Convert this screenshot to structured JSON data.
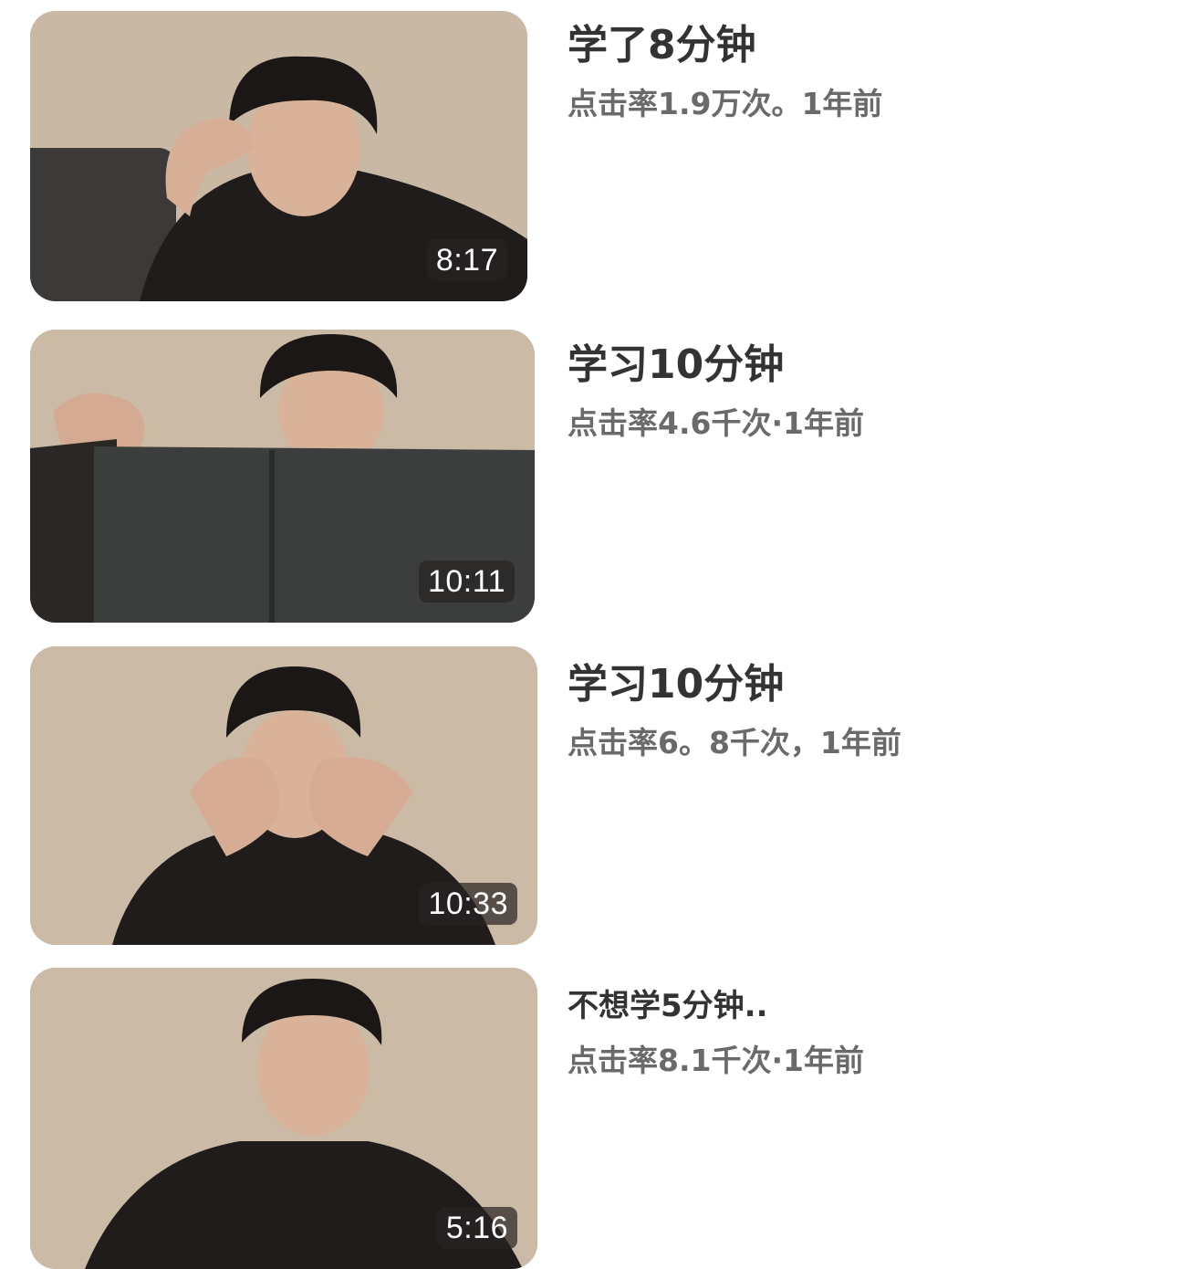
{
  "colors": {
    "background": "#ffffff",
    "title_text": "#333333",
    "subtitle_text": "#6a6a6a",
    "duration_badge_bg": "#282422",
    "thumbnail_wall": "#cbbba7"
  },
  "videos": [
    {
      "title": "学了8分钟",
      "stats": "点击率1.9万次。1年前",
      "duration": "8:17"
    },
    {
      "title": "学习10分钟",
      "stats": "点击率4.6千次·1年前",
      "duration": "10:11"
    },
    {
      "title": "学习10分钟",
      "stats": "点击率6。8千次，1年前",
      "duration": "10:33"
    },
    {
      "title": "不想学5分钟..",
      "stats": "点击率8.1千次·1年前",
      "duration": "5:16"
    }
  ]
}
